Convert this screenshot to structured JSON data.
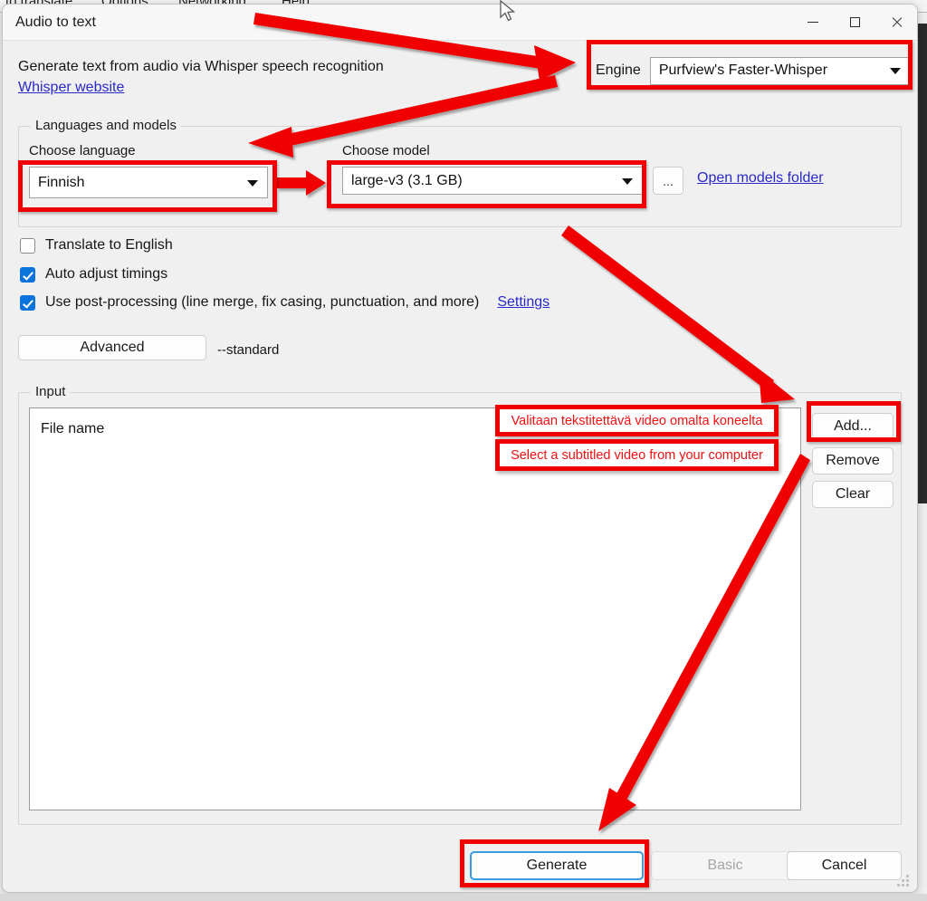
{
  "background_app": {
    "menu_items": [
      "to translate",
      "Options",
      "Networking",
      "Help"
    ]
  },
  "window": {
    "title": "Audio to text",
    "controls": {
      "minimize": "Minimize",
      "maximize": "Maximize",
      "close": "Close"
    },
    "resize_grip": "Resize"
  },
  "header": {
    "description": "Generate text from audio via Whisper speech recognition",
    "website_link": "Whisper website"
  },
  "engine": {
    "label": "Engine",
    "value": "Purfview's Faster-Whisper"
  },
  "languages_group": {
    "title": "Languages and models",
    "language_label": "Choose language",
    "language_value": "Finnish",
    "model_label": "Choose model",
    "model_value": "large-v3 (3.1 GB)",
    "browse_button": "...",
    "open_models_folder": "Open models folder"
  },
  "options": {
    "translate_to_english": {
      "label": "Translate to English",
      "checked": false
    },
    "auto_adjust_timings": {
      "label": "Auto adjust timings",
      "checked": true
    },
    "post_processing": {
      "label": "Use post-processing (line merge, fix casing, punctuation, and more)",
      "checked": true
    },
    "settings_link": "Settings",
    "advanced_button": "Advanced",
    "advanced_value": "--standard"
  },
  "input_group": {
    "title": "Input",
    "column_header": "File name",
    "rows": [],
    "buttons": {
      "add": "Add...",
      "remove": "Remove",
      "clear": "Clear"
    }
  },
  "footer": {
    "generate": "Generate",
    "basic": "Basic",
    "cancel": "Cancel"
  },
  "annotations": {
    "callout_fi": "Valitaan tekstitettävä video omalta koneelta",
    "callout_en": "Select a subtitled video from your computer",
    "highlight_color": "#f00000",
    "text_color": "#f41010"
  }
}
